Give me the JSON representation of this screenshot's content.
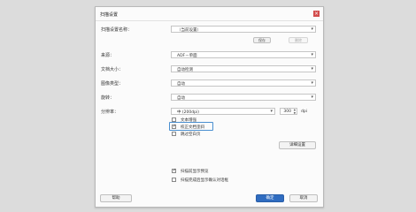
{
  "dialog": {
    "title": "扫描设置",
    "close_glyph": "×"
  },
  "form": {
    "preset_label": "扫描设置名称：",
    "preset_value": "（当前设置）",
    "save_button": "保存",
    "delete_button": "删除",
    "source_label": "来源：",
    "source_value": "ADF－单面",
    "size_label": "文档大小：",
    "size_value": "自动检测",
    "type_label": "图像类型：",
    "type_value": "自动",
    "rotate_label": "旋转：",
    "rotate_value": "自动",
    "resolution_label": "分辨率：",
    "resolution_value": "中 (200dpi)",
    "dpi_value": "300",
    "dpi_unit": "dpi",
    "checks": [
      {
        "label": "文本增强",
        "checked": false
      },
      {
        "label": "校正文档歪斜",
        "checked": true
      },
      {
        "label": "跳过空白页",
        "checked": false
      }
    ],
    "detail_button": "详细设置",
    "bottom_checks": [
      {
        "label": "扫描前显示预览",
        "checked": true
      },
      {
        "label": "扫描完成后显示确认对话框",
        "checked": false
      }
    ]
  },
  "footer": {
    "help_button": "帮助",
    "ok_button": "确定",
    "cancel_button": "取消"
  },
  "colors": {
    "accent": "#2f6cc0",
    "close": "#d24b4b"
  }
}
